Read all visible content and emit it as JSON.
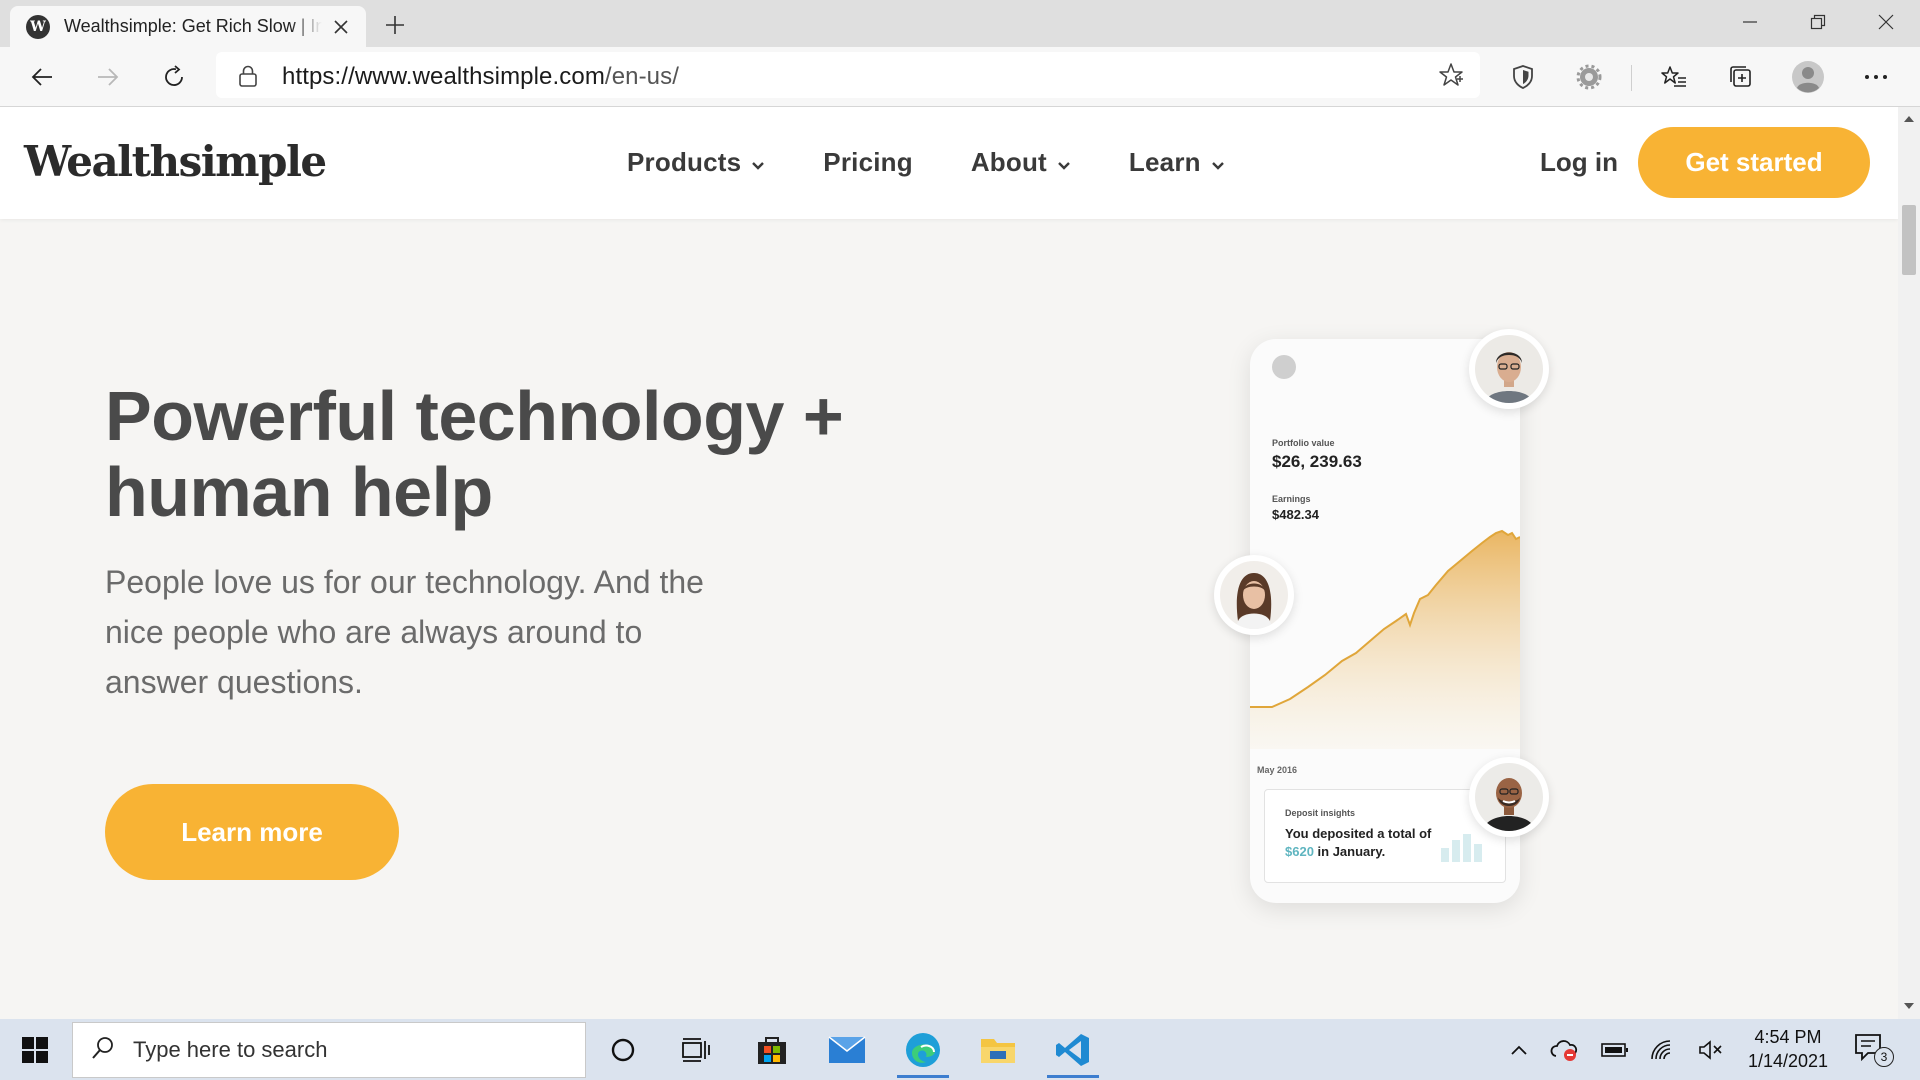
{
  "browser": {
    "tab_title": "Wealthsimple: Get Rich Slow | Investing",
    "tab_favicon_letter": "W",
    "url_host": "https://www.wealthsimple.com",
    "url_path": "/en-us/"
  },
  "site": {
    "logo": "Wealthsimple",
    "nav": [
      {
        "label": "Products",
        "has_dropdown": true
      },
      {
        "label": "Pricing",
        "has_dropdown": false
      },
      {
        "label": "About",
        "has_dropdown": true
      },
      {
        "label": "Learn",
        "has_dropdown": true
      }
    ],
    "login_label": "Log in",
    "cta_label": "Get started",
    "accent_color": "#f8b334"
  },
  "hero": {
    "title_line1": "Powerful technology +",
    "title_line2": "human help",
    "subtitle": "People love us for our technology. And the nice people who are always around to answer questions.",
    "button_label": "Learn more"
  },
  "phone": {
    "portfolio_label": "Portfolio value",
    "portfolio_value": "$26, 239.63",
    "earnings_label": "Earnings",
    "earnings_value": "$482.34",
    "chart_start_label": "May 2016",
    "insight_label": "Deposit insights",
    "insight_text_before": "You deposited a total of ",
    "insight_amount": "$620",
    "insight_text_after": " in January."
  },
  "taskbar": {
    "search_placeholder": "Type here to search",
    "time": "4:54 PM",
    "date": "1/14/2021",
    "notification_count": "3"
  }
}
